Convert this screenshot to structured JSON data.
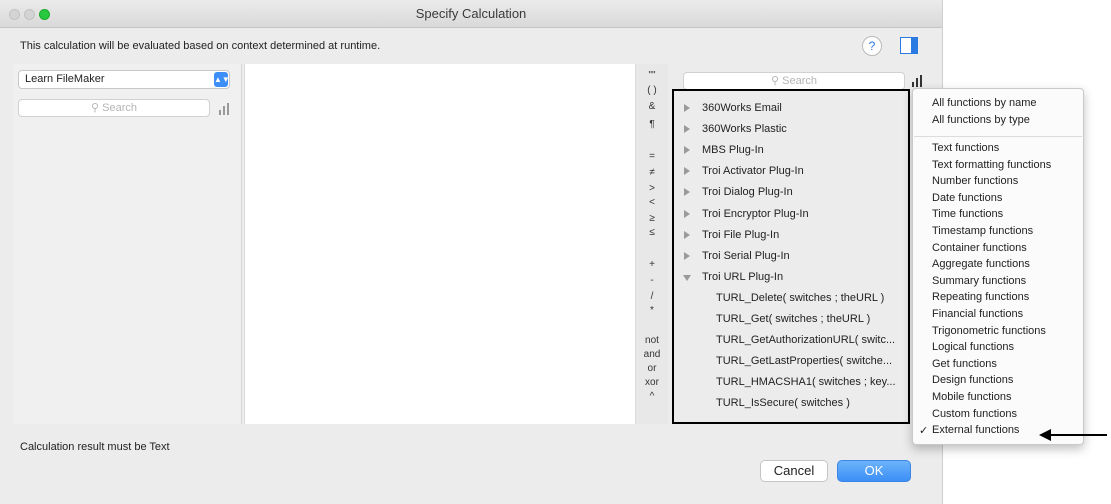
{
  "window": {
    "title": "Specify Calculation"
  },
  "header": {
    "context_text": "This calculation will be evaluated based on context determined at runtime.",
    "help_label": "?"
  },
  "left_pane": {
    "table_select_value": "Learn FileMaker",
    "search_placeholder": "Search"
  },
  "operators": [
    "\"\"",
    "( )",
    "&",
    "¶",
    "=",
    "≠",
    ">",
    "<",
    "≥",
    "≤",
    "+",
    "-",
    "/",
    "*",
    "not",
    "and",
    "or",
    "xor",
    "^"
  ],
  "functions_pane": {
    "search_placeholder": "Search",
    "items": [
      {
        "label": "360Works Email",
        "expanded": false
      },
      {
        "label": "360Works Plastic",
        "expanded": false
      },
      {
        "label": "MBS Plug-In",
        "expanded": false
      },
      {
        "label": "Troi Activator Plug-In",
        "expanded": false
      },
      {
        "label": "Troi Dialog Plug-In",
        "expanded": false
      },
      {
        "label": "Troi Encryptor Plug-In",
        "expanded": false
      },
      {
        "label": "Troi File Plug-In",
        "expanded": false
      },
      {
        "label": "Troi Serial Plug-In",
        "expanded": false
      },
      {
        "label": "Troi URL Plug-In",
        "expanded": true
      }
    ],
    "sub_items": [
      "TURL_Delete( switches ; theURL )",
      "TURL_Get( switches ; theURL )",
      "TURL_GetAuthorizationURL( switc...",
      "TURL_GetLastProperties( switche...",
      "TURL_HMACSHA1( switches ; key...",
      "TURL_IsSecure( switches )"
    ]
  },
  "function_type_menu": {
    "group1": [
      "All functions by name",
      "All functions by type"
    ],
    "group2": [
      "Text functions",
      "Text formatting functions",
      "Number functions",
      "Date functions",
      "Time functions",
      "Timestamp functions",
      "Container functions",
      "Aggregate functions",
      "Summary functions",
      "Repeating functions",
      "Financial functions",
      "Trigonometric functions",
      "Logical functions",
      "Get functions",
      "Design functions",
      "Mobile functions",
      "Custom functions",
      "External functions"
    ],
    "checkmark": "✓",
    "selected": "External functions"
  },
  "footer": {
    "result_text": "Calculation result must be  Text",
    "cancel_label": "Cancel",
    "ok_label": "OK"
  },
  "colors": {
    "accent": "#3b8ff6",
    "zoom_button": "#28c840"
  }
}
